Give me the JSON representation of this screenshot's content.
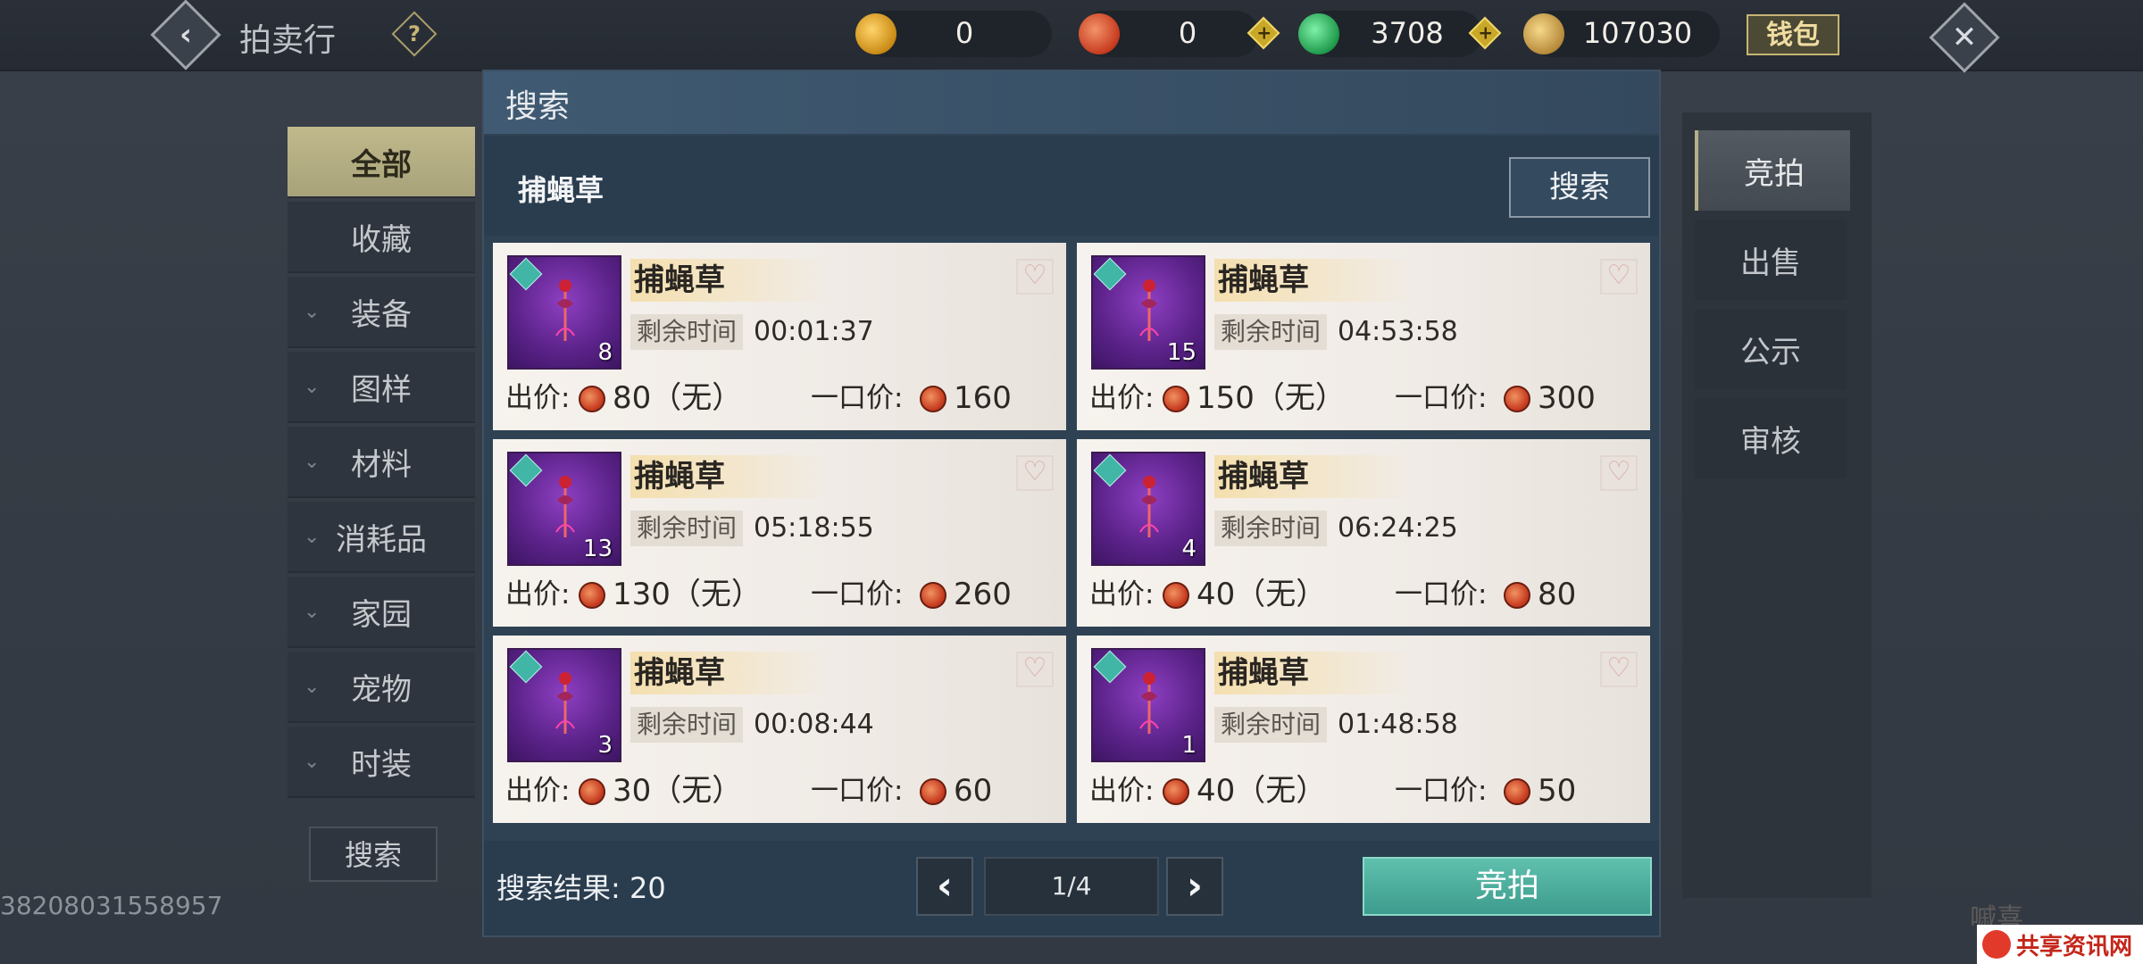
{
  "header": {
    "title": "拍卖行",
    "help_icon": "?",
    "currencies": [
      {
        "icon": "gold-ingot-icon",
        "value": "0"
      },
      {
        "icon": "fire-coin-icon",
        "value": "0"
      },
      {
        "icon": "jade-icon",
        "value": "3708"
      },
      {
        "icon": "silver-ingot-icon",
        "value": "107030"
      }
    ],
    "wallet_label": "钱包"
  },
  "sidebar": {
    "items": [
      {
        "label": "全部",
        "active": true
      },
      {
        "label": "收藏"
      },
      {
        "label": "装备",
        "expandable": true
      },
      {
        "label": "图样",
        "expandable": true
      },
      {
        "label": "材料",
        "expandable": true
      },
      {
        "label": "消耗品",
        "expandable": true
      },
      {
        "label": "家园",
        "expandable": true
      },
      {
        "label": "宠物",
        "expandable": true
      },
      {
        "label": "时装",
        "expandable": true
      }
    ],
    "search_label": "搜索",
    "uid": "38208031558957"
  },
  "main": {
    "title": "搜索",
    "query": "捕蝇草",
    "search_button": "搜索",
    "time_label": "剩余时间",
    "bid_label": "出价:",
    "buyout_label": "一口价:",
    "listings": [
      {
        "name": "捕蝇草",
        "qty": "8",
        "time": "00:01:37",
        "bid": "80（无）",
        "buyout": "160"
      },
      {
        "name": "捕蝇草",
        "qty": "15",
        "time": "04:53:58",
        "bid": "150（无）",
        "buyout": "300"
      },
      {
        "name": "捕蝇草",
        "qty": "13",
        "time": "05:18:55",
        "bid": "130（无）",
        "buyout": "260"
      },
      {
        "name": "捕蝇草",
        "qty": "4",
        "time": "06:24:25",
        "bid": "40（无）",
        "buyout": "80"
      },
      {
        "name": "捕蝇草",
        "qty": "3",
        "time": "00:08:44",
        "bid": "30（无）",
        "buyout": "60"
      },
      {
        "name": "捕蝇草",
        "qty": "1",
        "time": "01:48:58",
        "bid": "40（无）",
        "buyout": "50"
      }
    ],
    "result_label": "搜索结果:",
    "result_count": "20",
    "page": "1/4",
    "bid_button": "竞拍"
  },
  "right_tabs": [
    {
      "label": "竞拍",
      "active": true
    },
    {
      "label": "出售"
    },
    {
      "label": "公示"
    },
    {
      "label": "审核"
    }
  ],
  "watermark": {
    "text1": "嘁喜",
    "text2": "共享资讯网"
  }
}
